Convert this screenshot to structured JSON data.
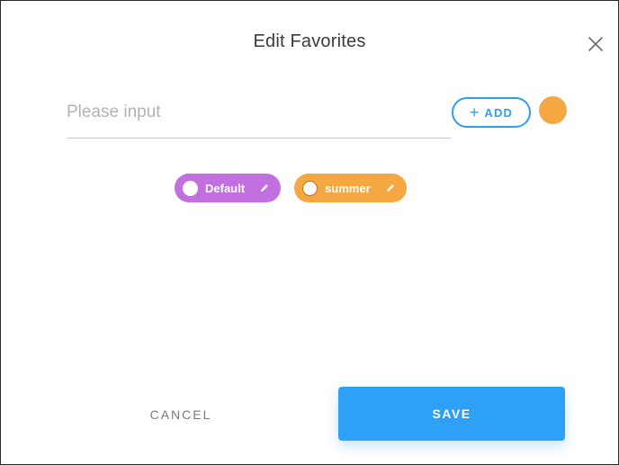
{
  "dialog": {
    "title": "Edit Favorites"
  },
  "input": {
    "placeholder": "Please input",
    "value": ""
  },
  "add_button": {
    "plus": "+",
    "label": "ADD"
  },
  "selected_color": "#f5a742",
  "tags": [
    {
      "label": "Default",
      "color": "#c26fe0"
    },
    {
      "label": "summer",
      "color": "#f5a742"
    }
  ],
  "footer": {
    "cancel_label": "CANCEL",
    "save_label": "SAVE"
  },
  "colors": {
    "accent": "#2ea0f5"
  }
}
